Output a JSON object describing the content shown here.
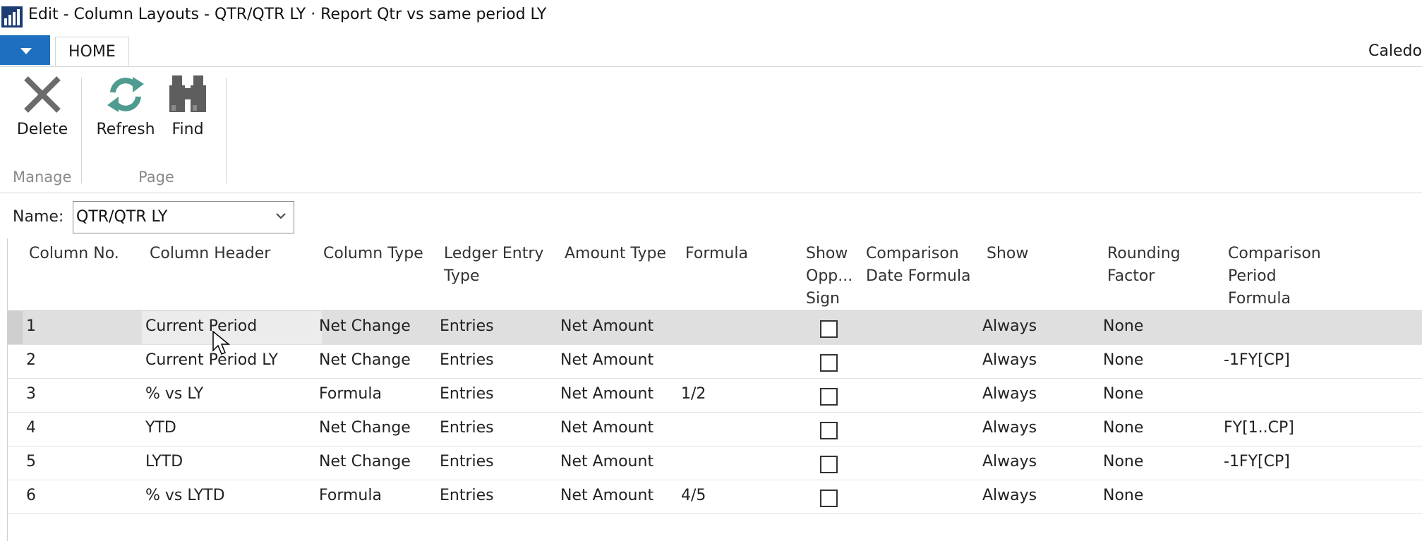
{
  "window": {
    "title": "Edit - Column Layouts - QTR/QTR LY · Report Qtr vs same period LY"
  },
  "ribbon": {
    "tab": "HOME",
    "company": "Caledon",
    "groups": [
      {
        "label": "Manage",
        "buttons": [
          {
            "label": "Delete",
            "icon": "delete-x-icon"
          }
        ]
      },
      {
        "label": "Page",
        "buttons": [
          {
            "label": "Refresh",
            "icon": "refresh-icon"
          },
          {
            "label": "Find",
            "icon": "binoculars-icon"
          }
        ]
      }
    ]
  },
  "name_field": {
    "label": "Name:",
    "value": "QTR/QTR LY"
  },
  "columns": [
    {
      "key": "col_no",
      "lines": [
        "Column No."
      ]
    },
    {
      "key": "header",
      "lines": [
        "Column Header"
      ]
    },
    {
      "key": "type",
      "lines": [
        "Column Type"
      ]
    },
    {
      "key": "ledger",
      "lines": [
        "Ledger Entry",
        "Type"
      ]
    },
    {
      "key": "amount",
      "lines": [
        "Amount Type"
      ]
    },
    {
      "key": "formula",
      "lines": [
        "Formula"
      ]
    },
    {
      "key": "opp_sign",
      "lines": [
        "Show",
        "Opp...",
        "Sign"
      ]
    },
    {
      "key": "cmp_date",
      "lines": [
        "Comparison",
        "Date Formula"
      ]
    },
    {
      "key": "show",
      "lines": [
        "Show"
      ]
    },
    {
      "key": "rounding",
      "lines": [
        "Rounding",
        "Factor"
      ]
    },
    {
      "key": "cmp_period",
      "lines": [
        "Comparison",
        "Period",
        "Formula"
      ]
    }
  ],
  "rows": [
    {
      "col_no": "1",
      "header": "Current Period",
      "type": "Net Change",
      "ledger": "Entries",
      "amount": "Net Amount",
      "formula": "",
      "opp_sign": false,
      "cmp_date": "",
      "show": "Always",
      "rounding": "None",
      "cmp_period": "",
      "selected": true
    },
    {
      "col_no": "2",
      "header": "Current Period LY",
      "type": "Net Change",
      "ledger": "Entries",
      "amount": "Net Amount",
      "formula": "",
      "opp_sign": false,
      "cmp_date": "",
      "show": "Always",
      "rounding": "None",
      "cmp_period": "-1FY[CP]"
    },
    {
      "col_no": "3",
      "header": "% vs LY",
      "type": "Formula",
      "ledger": "Entries",
      "amount": "Net Amount",
      "formula": "1/2",
      "opp_sign": false,
      "cmp_date": "",
      "show": "Always",
      "rounding": "None",
      "cmp_period": ""
    },
    {
      "col_no": "4",
      "header": "YTD",
      "type": "Net Change",
      "ledger": "Entries",
      "amount": "Net Amount",
      "formula": "",
      "opp_sign": false,
      "cmp_date": "",
      "show": "Always",
      "rounding": "None",
      "cmp_period": "FY[1..CP]"
    },
    {
      "col_no": "5",
      "header": "LYTD",
      "type": "Net Change",
      "ledger": "Entries",
      "amount": "Net Amount",
      "formula": "",
      "opp_sign": false,
      "cmp_date": "",
      "show": "Always",
      "rounding": "None",
      "cmp_period": "-1FY[CP]"
    },
    {
      "col_no": "6",
      "header": "% vs LYTD",
      "type": "Formula",
      "ledger": "Entries",
      "amount": "Net Amount",
      "formula": "4/5",
      "opp_sign": false,
      "cmp_date": "",
      "show": "Always",
      "rounding": "None",
      "cmp_period": ""
    }
  ]
}
